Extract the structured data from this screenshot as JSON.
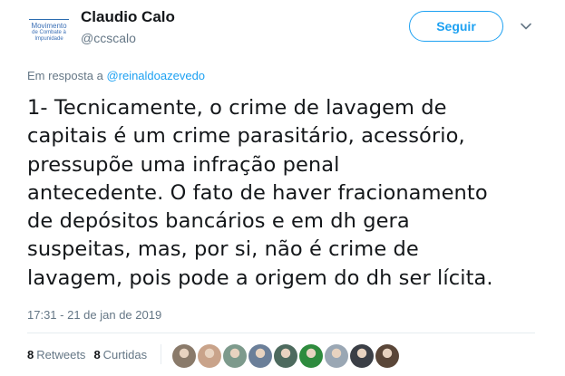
{
  "author": {
    "name": "Claudio Calo",
    "handle": "@ccscalo",
    "avatar_text_line1": "Movimento",
    "avatar_text_line2": "de Combate à",
    "avatar_text_line3": "Impunidade"
  },
  "follow_button": {
    "label": "Seguir"
  },
  "reply": {
    "prefix": "Em resposta a ",
    "mention": "@reinaldoazevedo"
  },
  "tweet": {
    "lines": [
      "1- Tecnicamente, o crime de lavagem de",
      "capitais é um crime parasitário, acessório,",
      "pressupõe uma infração penal",
      "antecedente. O fato de haver fracionamento",
      "de depósitos bancários e em dh gera",
      "suspeitas, mas, por si, não é crime de",
      "lavagem, pois pode a origem do dh ser lícita."
    ]
  },
  "timestamp": "17:31 - 21 de jan de 2019",
  "stats": {
    "retweets_count": "8",
    "retweets_label": "Retweets",
    "likes_count": "8",
    "likes_label": "Curtidas"
  },
  "likers": [
    {
      "icon": "user-avatar",
      "color": "#8a7a6a"
    },
    {
      "icon": "user-avatar",
      "color": "#c9a38a"
    },
    {
      "icon": "user-avatar",
      "color": "#7d9a8c"
    },
    {
      "icon": "user-avatar",
      "color": "#6b7f99"
    },
    {
      "icon": "user-avatar",
      "color": "#4d6a5e"
    },
    {
      "icon": "user-avatar",
      "color": "#2e8b3e"
    },
    {
      "icon": "user-avatar",
      "color": "#9aa7b4"
    },
    {
      "icon": "user-avatar",
      "color": "#3b3f46"
    },
    {
      "icon": "user-avatar",
      "color": "#5a4638"
    }
  ],
  "colors": {
    "accent": "#1da1f2",
    "text": "#14171a",
    "muted": "#657786"
  }
}
